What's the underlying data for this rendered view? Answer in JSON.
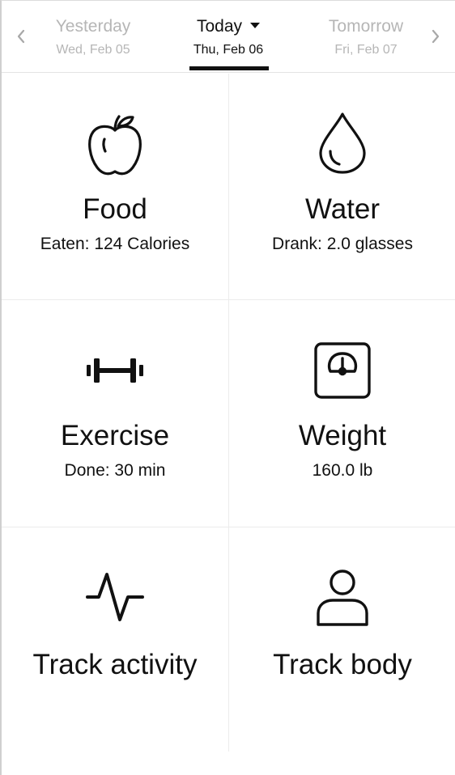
{
  "date_nav": {
    "yesterday": {
      "name": "Yesterday",
      "date": "Wed, Feb 05"
    },
    "today": {
      "name": "Today",
      "date": "Thu, Feb 06"
    },
    "tomorrow": {
      "name": "Tomorrow",
      "date": "Fri, Feb 07"
    },
    "icons": {
      "prev": "chevron-left-icon",
      "next": "chevron-right-icon",
      "dropdown": "caret-down-icon"
    }
  },
  "tiles": {
    "food": {
      "title": "Food",
      "subtitle": "Eaten: 124 Calories",
      "icon": "apple-icon"
    },
    "water": {
      "title": "Water",
      "subtitle": "Drank: 2.0 glasses",
      "icon": "water-drop-icon"
    },
    "exercise": {
      "title": "Exercise",
      "subtitle": "Done: 30 min",
      "icon": "dumbbell-icon"
    },
    "weight": {
      "title": "Weight",
      "subtitle": "160.0 lb",
      "icon": "scale-icon"
    },
    "track_activity": {
      "title": "Track activity",
      "icon": "pulse-icon"
    },
    "track_body": {
      "title": "Track body",
      "icon": "person-icon"
    }
  },
  "colors": {
    "text": "#111111",
    "inactive_text": "#b6b6b6",
    "divider": "#ececec",
    "background": "#ffffff"
  }
}
